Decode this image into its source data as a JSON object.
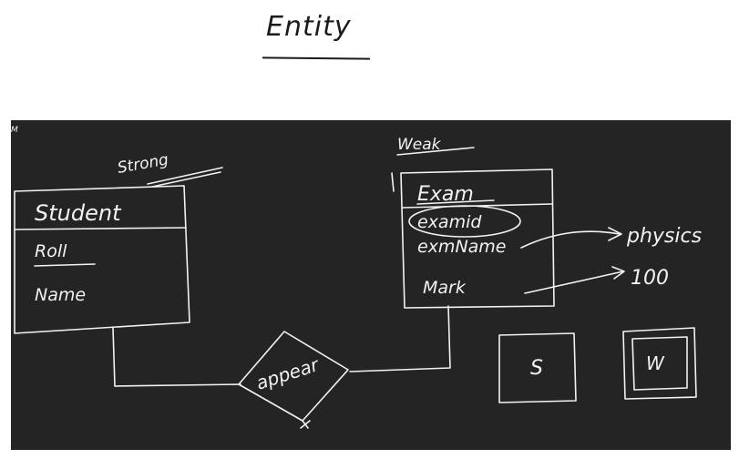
{
  "heading": {
    "title": "Entity"
  },
  "board": {
    "corner_mark": "M",
    "strong_entity": {
      "tag": "Strong",
      "name": "Student",
      "key_attribute": "Roll",
      "attribute": "Name"
    },
    "weak_entity": {
      "tag": "Weak",
      "name": "Exam",
      "partial_key": "examid",
      "attributes": [
        "exmName",
        "Mark"
      ]
    },
    "relationship": "appear",
    "value_examples": [
      "physics",
      "100"
    ],
    "legend": {
      "strong_symbol": "S",
      "weak_symbol": "W"
    }
  }
}
